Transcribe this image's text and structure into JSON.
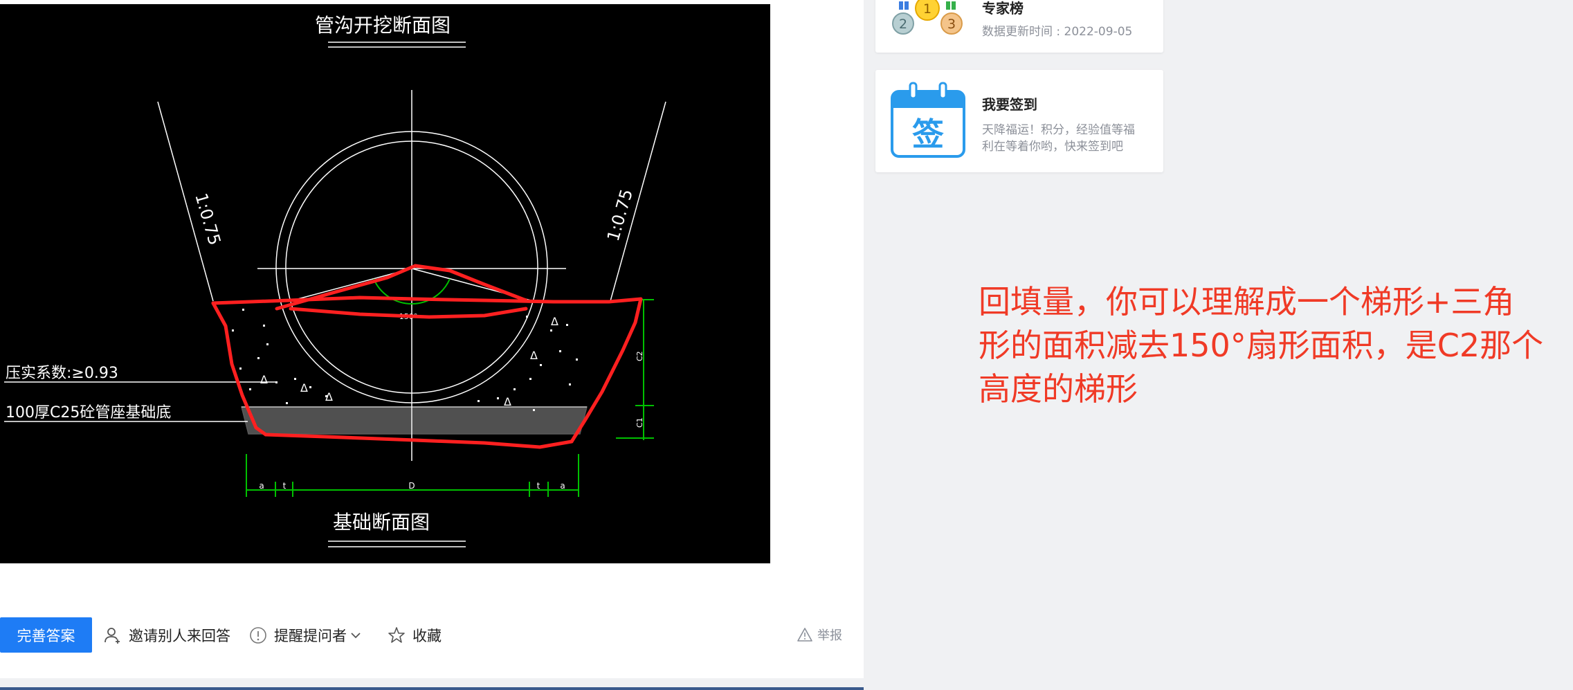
{
  "drawing": {
    "title_top": "管沟开挖断面图",
    "title_bottom": "基础断面图",
    "slope_left": "1:0.75",
    "slope_right": "1:0.75",
    "compaction_label": "压实系数:≥0.93",
    "base_label": "100厚C25砼管座基础底",
    "angle_label": "150°",
    "dim_a_left": "a",
    "dim_t_left": "t",
    "dim_d": "D",
    "dim_t_right": "t",
    "dim_a_right": "a",
    "dim_c2": "C2",
    "dim_c1": "C1"
  },
  "actions": {
    "complete_answer": "完善答案",
    "invite": "邀请别人来回答",
    "remind": "提醒提问者",
    "favorite": "收藏",
    "report": "举报"
  },
  "sidebar": {
    "expert": {
      "title": "专家榜",
      "updated": "数据更新时间 : 2022-09-05",
      "medals": [
        "2",
        "1",
        "3"
      ]
    },
    "signin": {
      "title": "我要签到",
      "icon_char": "签",
      "desc_line1": "天降福运！积分，经验值等福",
      "desc_line2": "利在等着你哟，快来签到吧"
    }
  },
  "annotation": {
    "line1": "回填量，你可以理解成一个梯形+三角",
    "line2": "形的面积减去150°扇形面积，是C2那个",
    "line3": "高度的梯形"
  },
  "colors": {
    "primary": "#1e7cf5",
    "annotation_red": "#f03a26",
    "markup_red": "#ff2020",
    "dimension_green": "#00c000"
  }
}
